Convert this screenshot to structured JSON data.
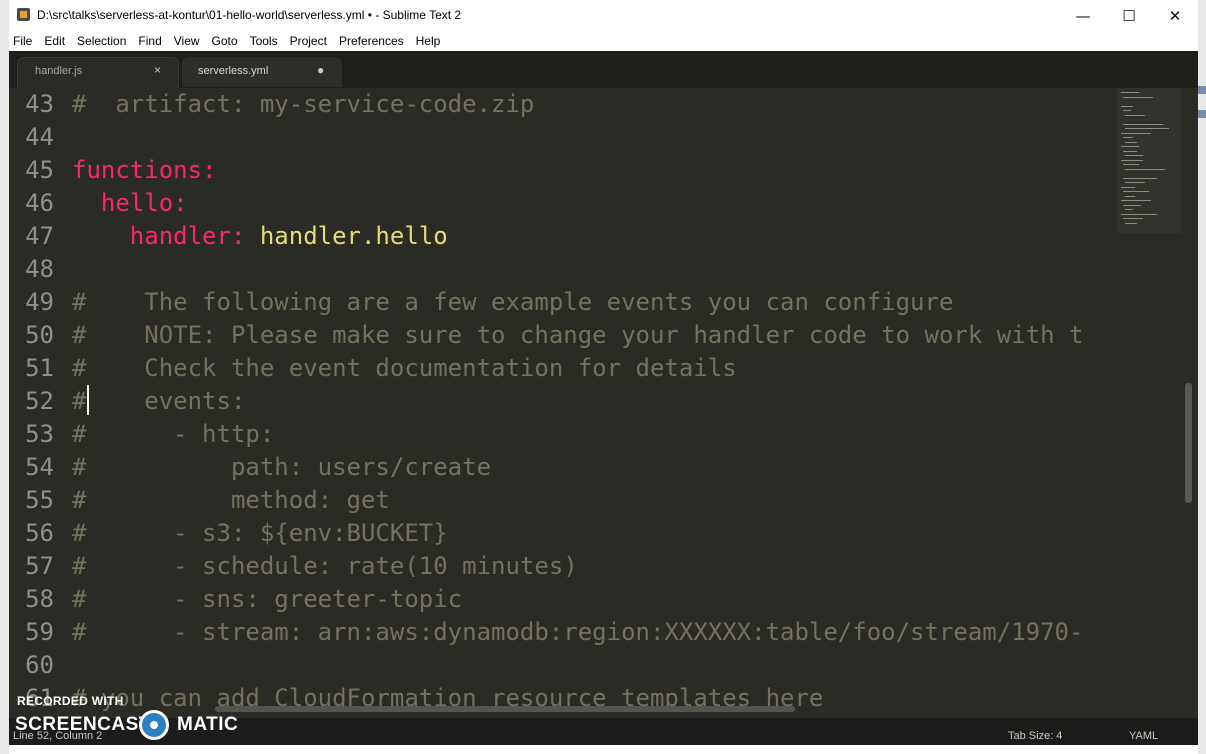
{
  "window": {
    "title": "D:\\src\\talks\\serverless-at-kontur\\01-hello-world\\serverless.yml • - Sublime Text 2",
    "minimize_glyph": "—",
    "maximize_glyph": "☐",
    "close_glyph": "✕"
  },
  "menu": {
    "items": [
      "File",
      "Edit",
      "Selection",
      "Find",
      "View",
      "Goto",
      "Tools",
      "Project",
      "Preferences",
      "Help"
    ]
  },
  "tabs": [
    {
      "label": "handler.js",
      "control": "×",
      "active": false
    },
    {
      "label": "serverless.yml",
      "control": "●",
      "active": true
    }
  ],
  "editor": {
    "lines": [
      {
        "num": "43",
        "code": "#  artifact: my-service-code.zip",
        "style": "comment"
      },
      {
        "num": "44",
        "code": "",
        "style": "plain"
      },
      {
        "num": "45",
        "code": "functions:",
        "style": "key"
      },
      {
        "num": "46",
        "code": "  hello:",
        "style": "key"
      },
      {
        "num": "47",
        "key": "    handler:",
        "value": " handler.hello",
        "style": "keyvalue"
      },
      {
        "num": "48",
        "code": "",
        "style": "plain"
      },
      {
        "num": "49",
        "code": "#    The following are a few example events you can configure",
        "style": "comment"
      },
      {
        "num": "50",
        "code": "#    NOTE: Please make sure to change your handler code to work with t",
        "style": "comment"
      },
      {
        "num": "51",
        "code": "#    Check the event documentation for details",
        "style": "comment"
      },
      {
        "num": "52",
        "code": "#    events:",
        "style": "comment"
      },
      {
        "num": "53",
        "code": "#      - http:",
        "style": "comment"
      },
      {
        "num": "54",
        "code": "#          path: users/create",
        "style": "comment"
      },
      {
        "num": "55",
        "code": "#          method: get",
        "style": "comment"
      },
      {
        "num": "56",
        "code": "#      - s3: ${env:BUCKET}",
        "style": "comment"
      },
      {
        "num": "57",
        "code": "#      - schedule: rate(10 minutes)",
        "style": "comment"
      },
      {
        "num": "58",
        "code": "#      - sns: greeter-topic",
        "style": "comment"
      },
      {
        "num": "59",
        "code": "#      - stream: arn:aws:dynamodb:region:XXXXXX:table/foo/stream/1970-",
        "style": "comment"
      },
      {
        "num": "60",
        "code": "",
        "style": "plain"
      },
      {
        "num": "61",
        "code": "# you can add CloudFormation resource templates here",
        "style": "comment"
      }
    ]
  },
  "status": {
    "position": "Line 52, Column 2",
    "tab_size": "Tab Size: 4",
    "syntax": "YAML"
  },
  "watermark": {
    "top": "RECORDED WITH",
    "left": "SCREENCAST",
    "right": "MATIC"
  },
  "colors": {
    "editor_bg": "#2b2b26",
    "comment": "#75715e",
    "keyword": "#f92672",
    "string": "#e6db74"
  }
}
